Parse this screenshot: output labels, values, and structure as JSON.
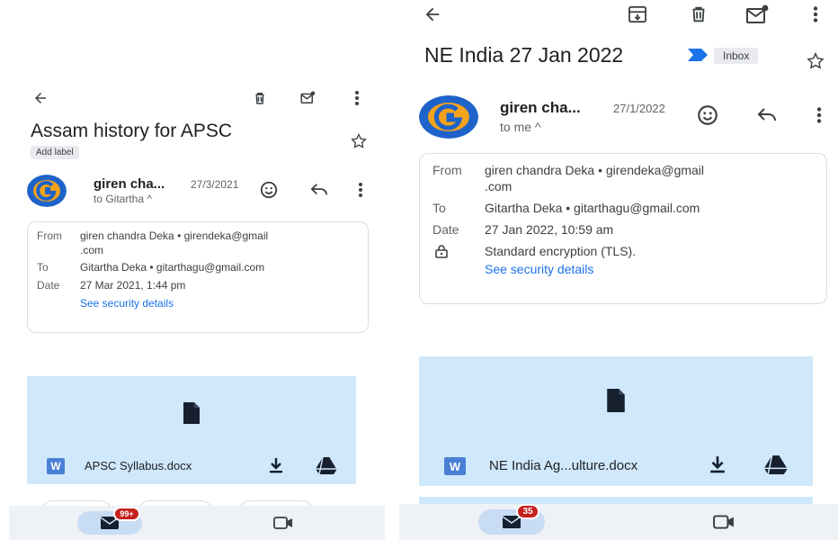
{
  "left": {
    "subject": "Assam history for APSC",
    "add_label": "Add label",
    "sender_short": "giren cha...",
    "date_short": "27/3/2021",
    "recipient_line": "to Gitartha ^",
    "details": {
      "from_key": "From",
      "from_value_1": "giren chandra Deka • girendeka@gmail",
      "from_value_2": ".com",
      "to_key": "To",
      "to_value": "Gitartha Deka • gitarthagu@gmail.com",
      "date_key": "Date",
      "date_value": "27 Mar 2021, 1:44 pm",
      "security_link": "See security details"
    },
    "attachment": {
      "badge": "W",
      "filename": "APSC Syllabus.docx"
    },
    "unread_badge": "99+"
  },
  "right": {
    "subject": "NE India 27 Jan 2022",
    "inbox_label": "Inbox",
    "sender_short": "giren cha...",
    "date_short": "27/1/2022",
    "recipient_line": "to me ^",
    "details": {
      "from_key": "From",
      "from_value_1": "giren chandra Deka • girendeka@gmail",
      "from_value_2": ".com",
      "to_key": "To",
      "to_value": "Gitartha Deka • gitarthagu@gmail.com",
      "date_key": "Date",
      "date_value": "27 Jan 2022, 10:59 am",
      "encryption": "Standard encryption (TLS).",
      "security_link": "See security details"
    },
    "attachment": {
      "badge": "W",
      "filename": "NE India Ag...ulture.docx"
    },
    "unread_badge": "35"
  },
  "colors": {
    "attachment_bg": "#cfe8fb",
    "link": "#1a73e8",
    "badge": "#c5221f",
    "word_badge": "#4a7fd6",
    "important_marker": "#1a73e8"
  },
  "icons": [
    "back-arrow-icon",
    "archive-icon",
    "delete-icon",
    "mark-unread-icon",
    "more-vert-icon",
    "star-icon",
    "emoji-icon",
    "reply-icon",
    "lock-icon",
    "file-icon",
    "download-icon",
    "drive-icon",
    "mail-icon",
    "video-icon",
    "important-marker-icon"
  ]
}
